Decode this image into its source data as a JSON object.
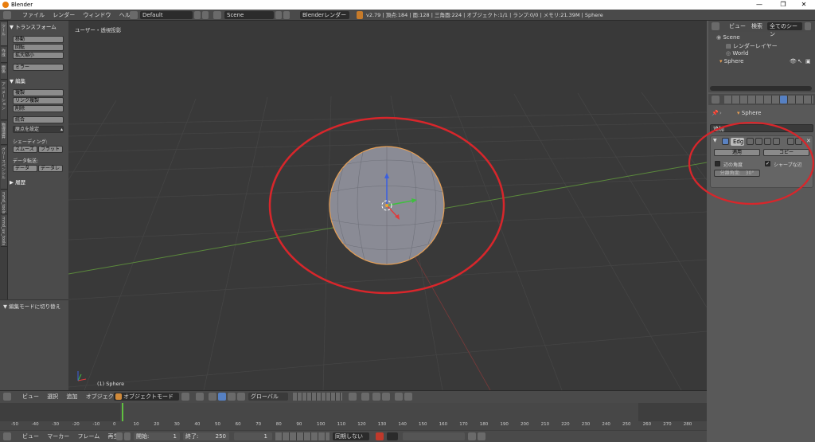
{
  "window": {
    "title": "Blender",
    "minimize": "—",
    "maximize": "❐",
    "close": "✕"
  },
  "infobar": {
    "menus": [
      "ファイル",
      "レンダー",
      "ウィンドウ",
      "ヘルプ"
    ],
    "screen_layout": "Default",
    "scene": "Scene",
    "render_engine": "Blenderレンダー",
    "stats": "v2.79 | 頂点:184 | 面:128 | 三角面:224 | オブジェクト:1/1 | ランプ:0/0 | メモリ:21.39M | Sphere"
  },
  "toolshelf": {
    "tabs": [
      "ツール",
      "作成",
      "関係",
      "アニメーション",
      "物理演算",
      "グリースペンシル",
      "mmd_tools",
      "mmd_uv_tools"
    ],
    "transform_header": "▼ トランスフォーム",
    "transform_buttons": [
      "移動",
      "回転",
      "拡大縮小"
    ],
    "mirror_button": "ミラー",
    "edit_header": "▼ 編集",
    "edit_buttons": [
      "複製",
      "リンク複製",
      "削除"
    ],
    "join_button": "統合",
    "origin_dropdown": "原点を設定",
    "shading_label": "シェーディング:",
    "smooth_button": "スムーズ",
    "flat_button": "フラット",
    "data_transfer_label": "データ転送:",
    "data_button": "データ",
    "data_layer_button": "データレ",
    "history_header": "▶ 履歴",
    "operator_panel": "▼ 編集モードに切り替え"
  },
  "viewport": {
    "view_label": "ユーザー・透視投影",
    "object_label": "(1) Sphere"
  },
  "viewport_header": {
    "menus": [
      "ビュー",
      "選択",
      "追加",
      "オブジェクト"
    ],
    "mode": "オブジェクトモード",
    "orientation": "グローバル"
  },
  "timeline": {
    "frame_ticks": [
      "-50",
      "-40",
      "-30",
      "-20",
      "-10",
      "0",
      "10",
      "20",
      "30",
      "40",
      "50",
      "60",
      "70",
      "80",
      "90",
      "100",
      "110",
      "120",
      "130",
      "140",
      "150",
      "160",
      "170",
      "180",
      "190",
      "200",
      "210",
      "220",
      "230",
      "240",
      "250",
      "260",
      "270",
      "280"
    ],
    "menus": [
      "ビュー",
      "マーカー",
      "フレーム",
      "再生"
    ],
    "start_label": "開始:",
    "start_value": "1",
    "end_label": "終了:",
    "end_value": "250",
    "current_frame": "1",
    "sync": "同期しない"
  },
  "outliner": {
    "view_menu": "ビュー",
    "search_menu": "検索",
    "filter": "全てのシーン",
    "items": [
      "Scene",
      "レンダーレイヤー",
      "World",
      "Sphere"
    ]
  },
  "properties": {
    "breadcrumb_object": "Sphere",
    "add_modifier": "追加",
    "modifier_name": "Edg",
    "apply_button": "適用",
    "copy_button": "コピー",
    "edge_angle_label": "辺の角度",
    "edge_angle_checked": false,
    "sharp_edges_label": "シャープな辺",
    "sharp_edges_checked": true,
    "split_angle": "分離角度:　30°"
  },
  "colors": {
    "annotation": "#d8262b",
    "selection_outline": "#e8a055",
    "accent": "#5680c2"
  }
}
